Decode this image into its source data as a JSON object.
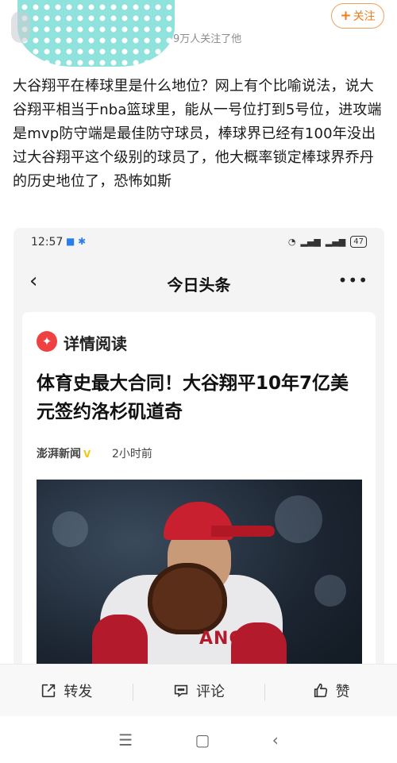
{
  "header": {
    "followers_text": "9万人关注了他",
    "follow_label": "关注"
  },
  "post": {
    "text": "大谷翔平在棒球里是什么地位？网上有个比喻说法，说大谷翔平相当于nba篮球里，能从一号位打到5号位，进攻端是mvp防守端是最佳防守球员，棒球界已经有100年没出过大谷翔平这个级别的球员了，他大概率锁定棒球界乔丹的历史地位了，恐怖如斯"
  },
  "screenshot": {
    "status": {
      "time": "12:57",
      "battery": "47"
    },
    "app_title": "今日头条",
    "card": {
      "badge_label": "详情阅读",
      "headline": "体育史最大合同！大谷翔平10年7亿美元签约洛杉矶道奇",
      "source": "澎湃新闻",
      "time_ago": "2小时前",
      "jersey_text": "ANGEL"
    }
  },
  "actions": {
    "share_label": "转发",
    "comment_label": "评论",
    "like_label": "赞"
  },
  "colors": {
    "follow_accent": "#f07b17",
    "toutiao_red": "#f04142",
    "angels_red": "#b31b2c"
  }
}
